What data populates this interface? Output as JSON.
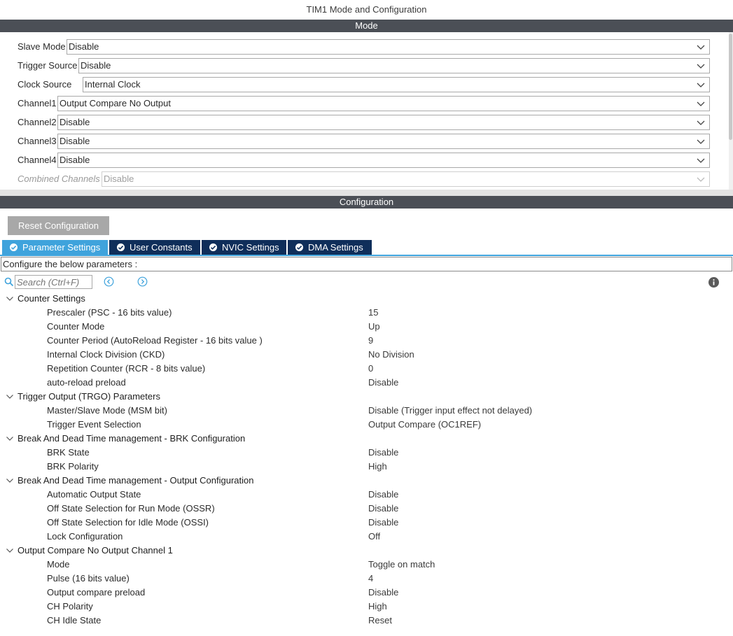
{
  "window": {
    "title": "TIM1 Mode and Configuration"
  },
  "mode_section": {
    "header": "Mode",
    "rows": [
      {
        "label": "Slave Mode",
        "value": "Disable"
      },
      {
        "label": "Trigger Source",
        "value": "Disable"
      },
      {
        "label": "Clock Source",
        "value": "Internal Clock"
      },
      {
        "label": "Channel1",
        "value": "Output Compare No Output"
      },
      {
        "label": "Channel2",
        "value": "Disable"
      },
      {
        "label": "Channel3",
        "value": "Disable"
      },
      {
        "label": "Channel4",
        "value": "Disable"
      },
      {
        "label": "Combined Channels",
        "value": "Disable"
      }
    ]
  },
  "config_section": {
    "header": "Configuration",
    "reset_label": "Reset Configuration",
    "tabs": [
      {
        "label": "Parameter Settings",
        "active": true
      },
      {
        "label": "User Constants",
        "active": false
      },
      {
        "label": "NVIC Settings",
        "active": false
      },
      {
        "label": "DMA Settings",
        "active": false
      }
    ],
    "hint": "Configure the below parameters :",
    "search_placeholder": "Search (Ctrl+F)"
  },
  "parameters": {
    "groups": [
      {
        "title": "Counter Settings",
        "items": [
          {
            "name": "Prescaler (PSC - 16 bits value)",
            "value": "15"
          },
          {
            "name": "Counter Mode",
            "value": "Up"
          },
          {
            "name": "Counter Period (AutoReload Register - 16 bits value )",
            "value": "9"
          },
          {
            "name": "Internal Clock Division (CKD)",
            "value": "No Division"
          },
          {
            "name": "Repetition Counter (RCR - 8 bits value)",
            "value": "0"
          },
          {
            "name": "auto-reload preload",
            "value": "Disable"
          }
        ]
      },
      {
        "title": "Trigger Output (TRGO) Parameters",
        "items": [
          {
            "name": "Master/Slave Mode (MSM bit)",
            "value": "Disable (Trigger input effect not delayed)"
          },
          {
            "name": "Trigger Event Selection",
            "value": "Output Compare (OC1REF)"
          }
        ]
      },
      {
        "title": "Break And Dead Time management - BRK Configuration",
        "items": [
          {
            "name": "BRK State",
            "value": "Disable"
          },
          {
            "name": "BRK Polarity",
            "value": "High"
          }
        ]
      },
      {
        "title": "Break And Dead Time management - Output Configuration",
        "items": [
          {
            "name": "Automatic Output State",
            "value": "Disable"
          },
          {
            "name": "Off State Selection for Run Mode (OSSR)",
            "value": "Disable"
          },
          {
            "name": "Off State Selection for Idle Mode (OSSI)",
            "value": "Disable"
          },
          {
            "name": "Lock Configuration",
            "value": "Off"
          }
        ]
      },
      {
        "title": "Output Compare No Output Channel 1",
        "items": [
          {
            "name": "Mode",
            "value": "Toggle on match"
          },
          {
            "name": "Pulse (16 bits value)",
            "value": "4"
          },
          {
            "name": "Output compare preload",
            "value": "Disable"
          },
          {
            "name": "CH Polarity",
            "value": "High"
          },
          {
            "name": "CH Idle State",
            "value": "Reset"
          }
        ]
      }
    ]
  },
  "colors": {
    "section_bar": "#4b4f56",
    "tab_active": "#3fa3dc",
    "tab_inactive": "#0f2e5a",
    "reset_button": "#a8a8a8"
  },
  "icons": {
    "dropdown": "chevron-down-icon",
    "tab_check": "check-circle-icon",
    "search": "search-icon",
    "prev": "previous-circle-icon",
    "next": "next-circle-icon",
    "info": "info-icon",
    "group_caret": "chevron-down-icon"
  }
}
